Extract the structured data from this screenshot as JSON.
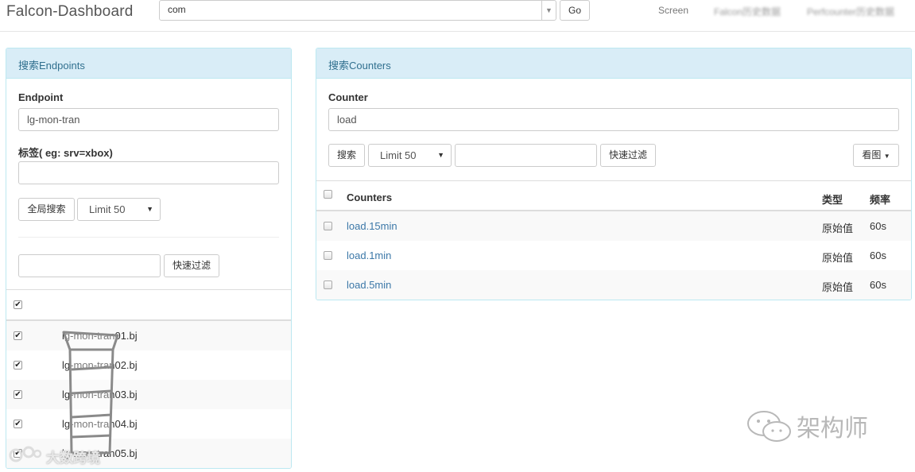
{
  "app": {
    "brand": "Falcon-Dashboard"
  },
  "topbar": {
    "endpoint_select_value": "com",
    "go_label": "Go",
    "nav": [
      {
        "label": "Screen"
      },
      {
        "label": "Falcon历史数据"
      },
      {
        "label": "Perfcounter历史数据"
      }
    ]
  },
  "endpoints_panel": {
    "heading": "搜索Endpoints",
    "endpoint_label": "Endpoint",
    "endpoint_value": "lg-mon-tran",
    "tags_label": "标签( eg: srv=xbox)",
    "tags_value": "",
    "global_search_label": "全局搜索",
    "limit_value": "Limit 50",
    "filter_value": "",
    "quick_filter_label": "快速过滤",
    "select_all_checked": true,
    "rows": [
      {
        "name": "lg-mon-tran01.bj",
        "checked": true
      },
      {
        "name": "lg-mon-tran02.bj",
        "checked": true
      },
      {
        "name": "lg-mon-tran03.bj",
        "checked": true
      },
      {
        "name": "lg-mon-tran04.bj",
        "checked": true
      },
      {
        "name": "lg-mon-tran05.bj",
        "checked": true
      }
    ]
  },
  "counters_panel": {
    "heading": "搜索Counters",
    "counter_label": "Counter",
    "counter_value": "load",
    "search_label": "搜索",
    "limit_value": "Limit 50",
    "filter_value": "",
    "quick_filter_label": "快速过滤",
    "view_graph_label": "看图",
    "columns": {
      "counters": "Counters",
      "type": "类型",
      "freq": "频率"
    },
    "rows": [
      {
        "counter": "load.15min",
        "type": "原始值",
        "freq": "60s"
      },
      {
        "counter": "load.1min",
        "type": "原始值",
        "freq": "60s"
      },
      {
        "counter": "load.5min",
        "type": "原始值",
        "freq": "60s"
      }
    ]
  },
  "watermarks": {
    "left": "大数跨境",
    "right": "架构师"
  },
  "colors": {
    "panel_heading_bg": "#d9edf7",
    "panel_border": "#bce8f1",
    "link": "#3c78a8",
    "stripe": "#f9f9f9"
  },
  "icons": [
    "caret-down-icon",
    "checkbox-checked-icon",
    "checkbox-icon",
    "wechat-icon"
  ]
}
